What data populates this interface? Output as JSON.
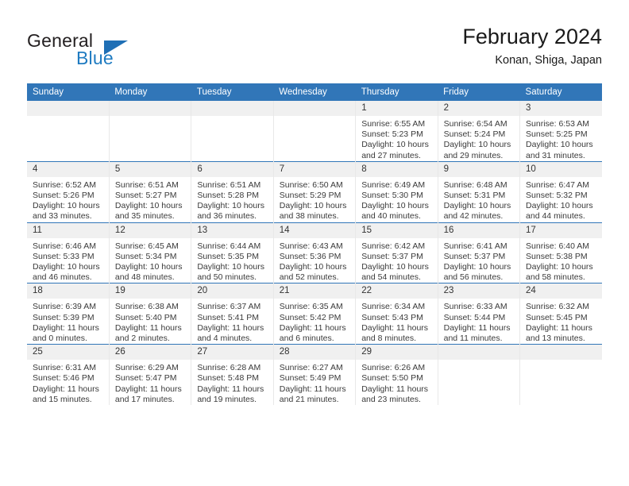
{
  "brand": {
    "line1": "General",
    "line2": "Blue",
    "triangle_icon": "triangle-icon",
    "color_dark": "#231f20",
    "color_blue": "#1f7bc1"
  },
  "header": {
    "title": "February 2024",
    "subtitle": "Konan, Shiga, Japan"
  },
  "theme": {
    "header_blue": "#3176b8",
    "daynum_band": "#f0f0f0",
    "text": "#3a3a3a"
  },
  "weekdays": [
    "Sunday",
    "Monday",
    "Tuesday",
    "Wednesday",
    "Thursday",
    "Friday",
    "Saturday"
  ],
  "labels": {
    "sunrise": "Sunrise:",
    "sunset": "Sunset:",
    "daylight": "Daylight:"
  },
  "weeks": [
    [
      {
        "day": "",
        "blank": true
      },
      {
        "day": "",
        "blank": true
      },
      {
        "day": "",
        "blank": true
      },
      {
        "day": "",
        "blank": true
      },
      {
        "day": "1",
        "sunrise": "Sunrise: 6:55 AM",
        "sunset": "Sunset: 5:23 PM",
        "daylight1": "Daylight: 10 hours",
        "daylight2": "and 27 minutes."
      },
      {
        "day": "2",
        "sunrise": "Sunrise: 6:54 AM",
        "sunset": "Sunset: 5:24 PM",
        "daylight1": "Daylight: 10 hours",
        "daylight2": "and 29 minutes."
      },
      {
        "day": "3",
        "sunrise": "Sunrise: 6:53 AM",
        "sunset": "Sunset: 5:25 PM",
        "daylight1": "Daylight: 10 hours",
        "daylight2": "and 31 minutes."
      }
    ],
    [
      {
        "day": "4",
        "sunrise": "Sunrise: 6:52 AM",
        "sunset": "Sunset: 5:26 PM",
        "daylight1": "Daylight: 10 hours",
        "daylight2": "and 33 minutes."
      },
      {
        "day": "5",
        "sunrise": "Sunrise: 6:51 AM",
        "sunset": "Sunset: 5:27 PM",
        "daylight1": "Daylight: 10 hours",
        "daylight2": "and 35 minutes."
      },
      {
        "day": "6",
        "sunrise": "Sunrise: 6:51 AM",
        "sunset": "Sunset: 5:28 PM",
        "daylight1": "Daylight: 10 hours",
        "daylight2": "and 36 minutes."
      },
      {
        "day": "7",
        "sunrise": "Sunrise: 6:50 AM",
        "sunset": "Sunset: 5:29 PM",
        "daylight1": "Daylight: 10 hours",
        "daylight2": "and 38 minutes."
      },
      {
        "day": "8",
        "sunrise": "Sunrise: 6:49 AM",
        "sunset": "Sunset: 5:30 PM",
        "daylight1": "Daylight: 10 hours",
        "daylight2": "and 40 minutes."
      },
      {
        "day": "9",
        "sunrise": "Sunrise: 6:48 AM",
        "sunset": "Sunset: 5:31 PM",
        "daylight1": "Daylight: 10 hours",
        "daylight2": "and 42 minutes."
      },
      {
        "day": "10",
        "sunrise": "Sunrise: 6:47 AM",
        "sunset": "Sunset: 5:32 PM",
        "daylight1": "Daylight: 10 hours",
        "daylight2": "and 44 minutes."
      }
    ],
    [
      {
        "day": "11",
        "sunrise": "Sunrise: 6:46 AM",
        "sunset": "Sunset: 5:33 PM",
        "daylight1": "Daylight: 10 hours",
        "daylight2": "and 46 minutes."
      },
      {
        "day": "12",
        "sunrise": "Sunrise: 6:45 AM",
        "sunset": "Sunset: 5:34 PM",
        "daylight1": "Daylight: 10 hours",
        "daylight2": "and 48 minutes."
      },
      {
        "day": "13",
        "sunrise": "Sunrise: 6:44 AM",
        "sunset": "Sunset: 5:35 PM",
        "daylight1": "Daylight: 10 hours",
        "daylight2": "and 50 minutes."
      },
      {
        "day": "14",
        "sunrise": "Sunrise: 6:43 AM",
        "sunset": "Sunset: 5:36 PM",
        "daylight1": "Daylight: 10 hours",
        "daylight2": "and 52 minutes."
      },
      {
        "day": "15",
        "sunrise": "Sunrise: 6:42 AM",
        "sunset": "Sunset: 5:37 PM",
        "daylight1": "Daylight: 10 hours",
        "daylight2": "and 54 minutes."
      },
      {
        "day": "16",
        "sunrise": "Sunrise: 6:41 AM",
        "sunset": "Sunset: 5:37 PM",
        "daylight1": "Daylight: 10 hours",
        "daylight2": "and 56 minutes."
      },
      {
        "day": "17",
        "sunrise": "Sunrise: 6:40 AM",
        "sunset": "Sunset: 5:38 PM",
        "daylight1": "Daylight: 10 hours",
        "daylight2": "and 58 minutes."
      }
    ],
    [
      {
        "day": "18",
        "sunrise": "Sunrise: 6:39 AM",
        "sunset": "Sunset: 5:39 PM",
        "daylight1": "Daylight: 11 hours",
        "daylight2": "and 0 minutes."
      },
      {
        "day": "19",
        "sunrise": "Sunrise: 6:38 AM",
        "sunset": "Sunset: 5:40 PM",
        "daylight1": "Daylight: 11 hours",
        "daylight2": "and 2 minutes."
      },
      {
        "day": "20",
        "sunrise": "Sunrise: 6:37 AM",
        "sunset": "Sunset: 5:41 PM",
        "daylight1": "Daylight: 11 hours",
        "daylight2": "and 4 minutes."
      },
      {
        "day": "21",
        "sunrise": "Sunrise: 6:35 AM",
        "sunset": "Sunset: 5:42 PM",
        "daylight1": "Daylight: 11 hours",
        "daylight2": "and 6 minutes."
      },
      {
        "day": "22",
        "sunrise": "Sunrise: 6:34 AM",
        "sunset": "Sunset: 5:43 PM",
        "daylight1": "Daylight: 11 hours",
        "daylight2": "and 8 minutes."
      },
      {
        "day": "23",
        "sunrise": "Sunrise: 6:33 AM",
        "sunset": "Sunset: 5:44 PM",
        "daylight1": "Daylight: 11 hours",
        "daylight2": "and 11 minutes."
      },
      {
        "day": "24",
        "sunrise": "Sunrise: 6:32 AM",
        "sunset": "Sunset: 5:45 PM",
        "daylight1": "Daylight: 11 hours",
        "daylight2": "and 13 minutes."
      }
    ],
    [
      {
        "day": "25",
        "sunrise": "Sunrise: 6:31 AM",
        "sunset": "Sunset: 5:46 PM",
        "daylight1": "Daylight: 11 hours",
        "daylight2": "and 15 minutes."
      },
      {
        "day": "26",
        "sunrise": "Sunrise: 6:29 AM",
        "sunset": "Sunset: 5:47 PM",
        "daylight1": "Daylight: 11 hours",
        "daylight2": "and 17 minutes."
      },
      {
        "day": "27",
        "sunrise": "Sunrise: 6:28 AM",
        "sunset": "Sunset: 5:48 PM",
        "daylight1": "Daylight: 11 hours",
        "daylight2": "and 19 minutes."
      },
      {
        "day": "28",
        "sunrise": "Sunrise: 6:27 AM",
        "sunset": "Sunset: 5:49 PM",
        "daylight1": "Daylight: 11 hours",
        "daylight2": "and 21 minutes."
      },
      {
        "day": "29",
        "sunrise": "Sunrise: 6:26 AM",
        "sunset": "Sunset: 5:50 PM",
        "daylight1": "Daylight: 11 hours",
        "daylight2": "and 23 minutes."
      },
      {
        "day": "",
        "blank": true
      },
      {
        "day": "",
        "blank": true
      }
    ]
  ]
}
